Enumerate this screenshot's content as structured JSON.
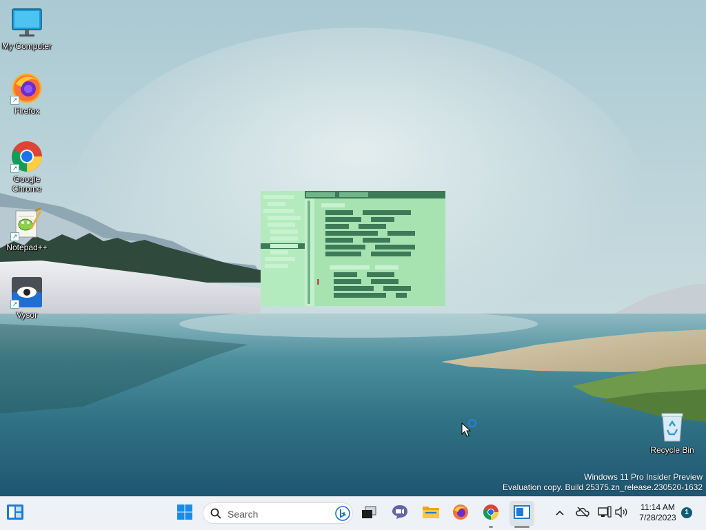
{
  "desktop": {
    "icons": [
      {
        "label": "My Computer",
        "icon": "computer-icon"
      },
      {
        "label": "Firefox",
        "icon": "firefox-icon"
      },
      {
        "label": "Google Chrome",
        "icon": "chrome-icon"
      },
      {
        "label": "Notepad++",
        "icon": "notepadpp-icon"
      },
      {
        "label": "Vysor",
        "icon": "vysor-icon"
      },
      {
        "label": "Recycle Bin",
        "icon": "recycle-bin-icon"
      }
    ]
  },
  "watermark": {
    "line1": "Windows 11 Pro Insider Preview",
    "line2": "Evaluation copy. Build 25375.zn_release.230520-1632"
  },
  "taskbar": {
    "search_placeholder": "Search",
    "apps": [
      "widgets-icon",
      "start-icon",
      "search-icon",
      "bing-icon",
      "task-view-icon",
      "teams-chat-icon",
      "file-explorer-icon",
      "firefox-icon",
      "chrome-icon",
      "active-app-icon"
    ],
    "tray": {
      "icons": [
        "chevron-up-icon",
        "onedrive-offline-icon",
        "network-icon",
        "volume-icon"
      ],
      "time": "11:14 AM",
      "date": "7/28/2023",
      "notification_count": "1"
    }
  },
  "colors": {
    "taskbar_bg": "#eef1f5",
    "splash_bg": "#a6e3b1",
    "splash_dark": "#3c7a58",
    "accent": "#0067c0"
  }
}
